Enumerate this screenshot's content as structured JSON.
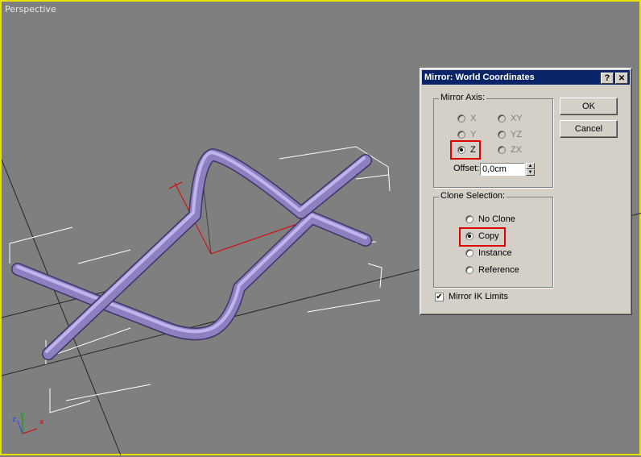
{
  "viewport": {
    "label": "Perspective",
    "axis_labels": {
      "x": "x",
      "y": "y",
      "z": "z"
    }
  },
  "dialog": {
    "title": "Mirror: World Coordinates",
    "help_button": "?",
    "close_button": "✕",
    "mirror_axis": {
      "label": "Mirror Axis:",
      "options": [
        "X",
        "Y",
        "Z",
        "XY",
        "YZ",
        "ZX"
      ],
      "selected": "Z",
      "offset_label": "Offset:",
      "offset_value": "0,0cm"
    },
    "clone_selection": {
      "label": "Clone Selection:",
      "options": [
        "No Clone",
        "Copy",
        "Instance",
        "Reference"
      ],
      "selected": "Copy"
    },
    "mirror_ik_label": "Mirror IK Limits",
    "mirror_ik_checked": true,
    "ok_label": "OK",
    "cancel_label": "Cancel"
  },
  "colors": {
    "viewport_bg": "#7f7f7f",
    "active_border": "#e8e000",
    "pipe": "#8e7fc0",
    "highlight": "#e00000",
    "title_bar": "#0a246a"
  }
}
